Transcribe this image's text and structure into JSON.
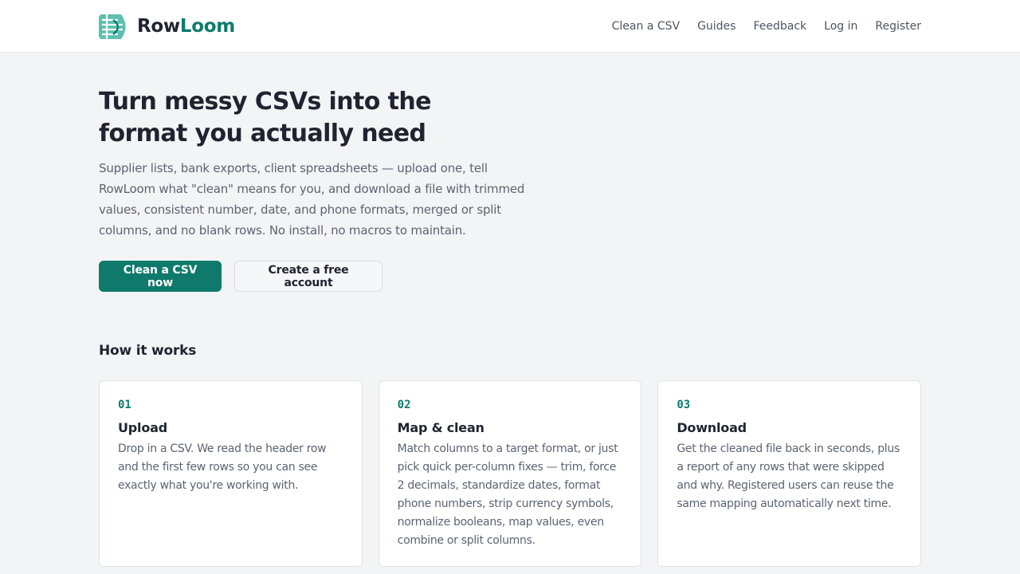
{
  "header": {
    "brand": {
      "name_part1": "Row",
      "name_part2": "Loom",
      "logo_icon": "rowloom-logo-icon"
    },
    "nav": [
      {
        "label": "Clean a CSV"
      },
      {
        "label": "Guides"
      },
      {
        "label": "Feedback"
      },
      {
        "label": "Log in"
      },
      {
        "label": "Register"
      }
    ]
  },
  "hero": {
    "title": "Turn messy CSVs into the format you actually need",
    "description": "Supplier lists, bank exports, client spreadsheets — upload one, tell RowLoom what \"clean\" means for you, and download a file with trimmed values, consistent number, date, and phone formats, merged or split columns, and no blank rows. No install, no macros to maintain.",
    "primary_cta": "Clean a CSV now",
    "secondary_cta": "Create a free account"
  },
  "how_it_works": {
    "title": "How it works",
    "steps": [
      {
        "number": "01",
        "title": "Upload",
        "text": "Drop in a CSV. We read the header row and the first few rows so you can see exactly what you're working with."
      },
      {
        "number": "02",
        "title": "Map & clean",
        "text": "Match columns to a target format, or just pick quick per-column fixes — trim, force 2 decimals, standardize dates, format phone numbers, strip currency symbols, normalize booleans, map values, even combine or split columns."
      },
      {
        "number": "03",
        "title": "Download",
        "text": "Get the cleaned file back in seconds, plus a report of any rows that were skipped and why. Registered users can reuse the same mapping automatically next time."
      }
    ]
  },
  "colors": {
    "accent": "#0f7a6c",
    "accent_light": "#5bc0b0",
    "text": "#1f2430",
    "muted": "#5b6472",
    "background": "#f3f4f6"
  }
}
